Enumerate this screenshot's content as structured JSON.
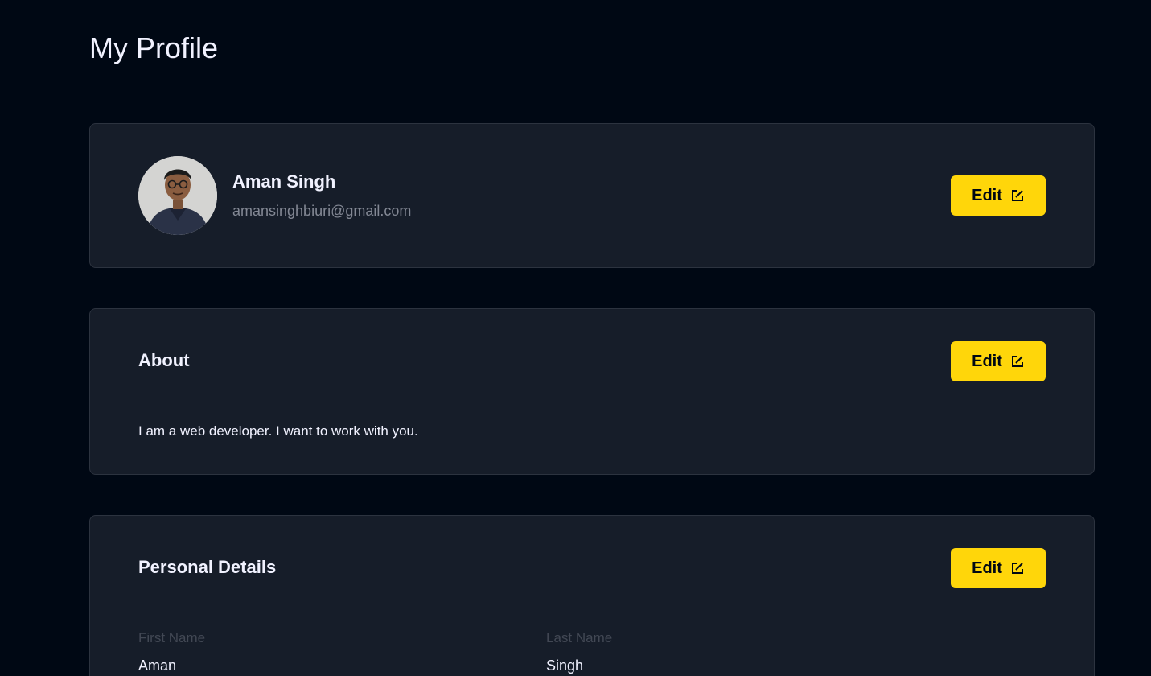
{
  "page": {
    "title": "My Profile"
  },
  "profile": {
    "name": "Aman Singh",
    "email": "amansinghbiuri@gmail.com",
    "edit_label": "Edit"
  },
  "about": {
    "title": "About",
    "text": "I am a web developer. I want to work with you.",
    "edit_label": "Edit"
  },
  "personal_details": {
    "title": "Personal Details",
    "edit_label": "Edit",
    "first_name_label": "First Name",
    "first_name_value": "Aman",
    "last_name_label": "Last Name",
    "last_name_value": "Singh"
  },
  "colors": {
    "background": "#000814",
    "card": "#161d29",
    "accent": "#ffd60a",
    "muted_text": "#838894"
  },
  "icons": {
    "edit": "edit-icon",
    "avatar": "user-avatar"
  }
}
